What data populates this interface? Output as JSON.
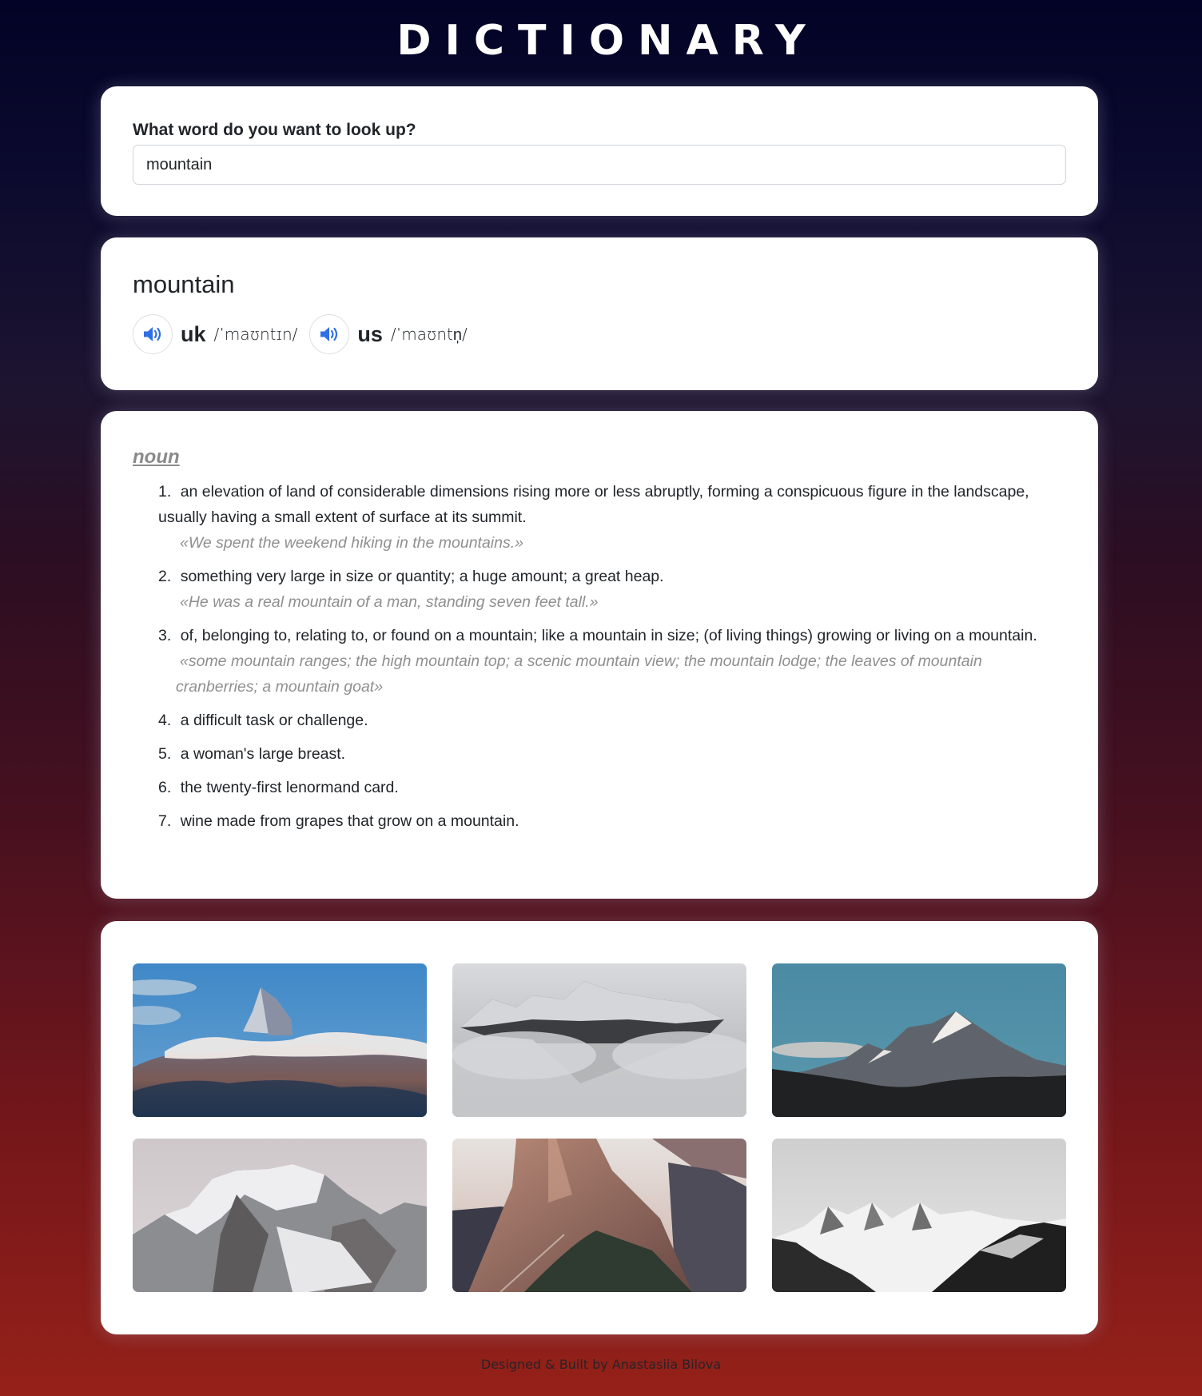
{
  "header": {
    "title": "DICTIONARY"
  },
  "search": {
    "label": "What word do you want to look up?",
    "value": "mountain",
    "placeholder": ""
  },
  "word": {
    "title": "mountain",
    "phonetics": [
      {
        "accent": "uk",
        "text": "/ˈmaʊntɪn/",
        "icon": "speaker-icon"
      },
      {
        "accent": "us",
        "text": "/ˈmaʊntn̩/",
        "icon": "speaker-icon"
      }
    ]
  },
  "meaning": {
    "part_of_speech": "noun",
    "definitions": [
      {
        "number": "1.",
        "text": "an elevation of land of considerable dimensions rising more or less abruptly, forming a conspicuous figure in the landscape, usually having a small extent of surface at its summit.",
        "example": "«We spent the weekend hiking in the mountains.»"
      },
      {
        "number": "2.",
        "text": "something very large in size or quantity; a huge amount; a great heap.",
        "example": "«He was a real mountain of a man, standing seven feet tall.»"
      },
      {
        "number": "3.",
        "text": "of, belonging to, relating to, or found on a mountain; like a mountain in size; (of living things) growing or living on a mountain.",
        "example": "«some mountain ranges; the high mountain top; a scenic mountain view; the mountain lodge; the leaves of mountain cranberries; a mountain goat»"
      },
      {
        "number": "4.",
        "text": "a difficult task or challenge.",
        "example": ""
      },
      {
        "number": "5.",
        "text": "a woman's large breast.",
        "example": ""
      },
      {
        "number": "6.",
        "text": "the twenty-first lenormand card.",
        "example": ""
      },
      {
        "number": "7.",
        "text": "wine made from grapes that grow on a mountain.",
        "example": ""
      }
    ]
  },
  "photos": [
    {
      "alt": "Snowy pointed peak above clouds, blue sky"
    },
    {
      "alt": "Snowy ridge emerging from fog"
    },
    {
      "alt": "Snow-capped peak against teal sky with dark forest"
    },
    {
      "alt": "Snow-covered rocky massif under pale sky"
    },
    {
      "alt": "Jagged sunlit rock ridge at dusk"
    },
    {
      "alt": "Black and white snowy mountain range"
    }
  ],
  "footer": {
    "prefix": "Designed & Built by ",
    "author": "Anastasiia Bilova"
  },
  "colors": {
    "accent_blue": "#2f6fe4",
    "background_top": "#020326",
    "background_bottom": "#952119",
    "example_gray": "#8f8f8f"
  }
}
